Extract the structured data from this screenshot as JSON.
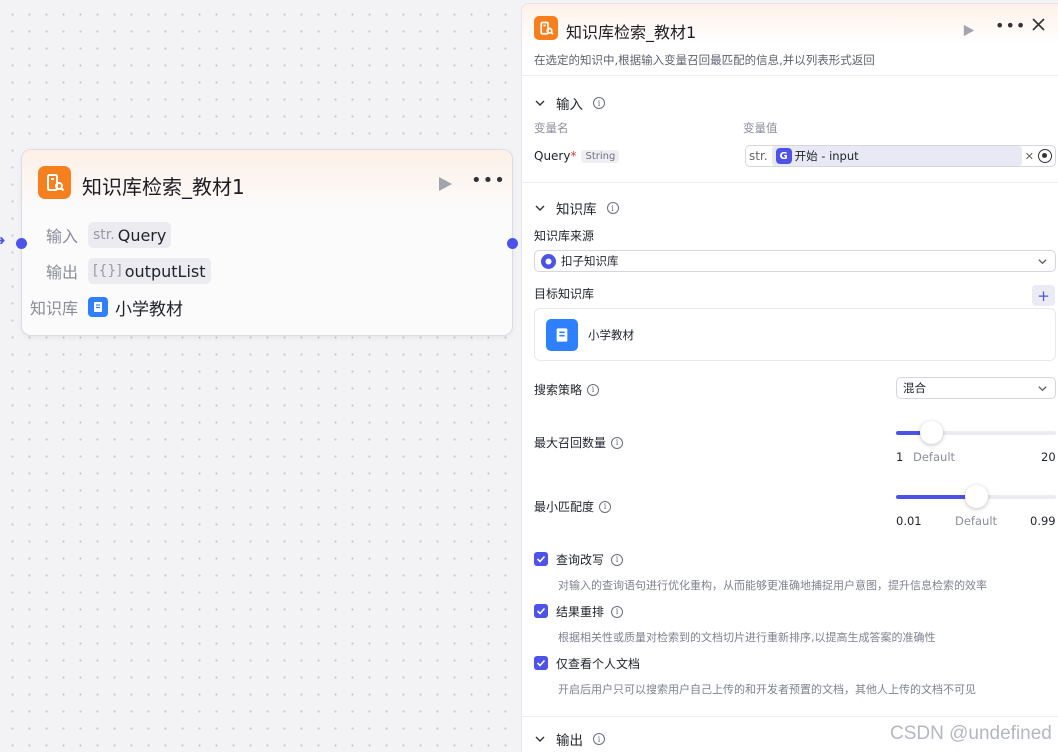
{
  "node": {
    "title": "知识库检索_教材1",
    "input_label": "输入",
    "input_type": "str.",
    "input_value": "Query",
    "output_label": "输出",
    "output_type": "[{}]",
    "output_value": "outputList",
    "kb_label": "知识库",
    "kb_value": "小学教材"
  },
  "panel": {
    "title": "知识库检索_教材1",
    "description": "在选定的知识中,根据输入变量召回最匹配的信息,并以列表形式返回",
    "input_section": {
      "title": "输入",
      "col_name": "变量名",
      "col_value": "变量值",
      "var_name": "Query",
      "required_mark": "*",
      "var_type": "String",
      "ref_prefix": "str.",
      "ref_value": "开始 - input"
    },
    "kb_section": {
      "title": "知识库",
      "source_label": "知识库来源",
      "source_value": "扣子知识库",
      "target_label": "目标知识库",
      "add_label": "+",
      "kb_item": "小学教材",
      "strategy_label": "搜索策略",
      "strategy_value": "混合",
      "max_recall_label": "最大召回数量",
      "max_recall_min": "1",
      "max_recall_default": "Default",
      "max_recall_max": "20",
      "max_recall_level": 0.22,
      "min_match_label": "最小匹配度",
      "min_match_min": "0.01",
      "min_match_default": "Default",
      "min_match_max": "0.99",
      "min_match_level": 0.5,
      "options": [
        {
          "label": "查询改写",
          "desc": "对输入的查询语句进行优化重构，从而能够更准确地捕捉用户意图，提升信息检索的效率",
          "checked": true
        },
        {
          "label": "结果重排",
          "desc": "根据相关性或质量对检索到的文档切片进行重新排序,以提高生成答案的准确性",
          "checked": true
        },
        {
          "label": "仅查看个人文档",
          "desc": "开启后用户只可以搜索用户自己上传的和开发者预置的文档，其他人上传的文档不可见",
          "checked": true
        }
      ]
    },
    "output_section": {
      "title": "输出"
    }
  },
  "watermark": "CSDN @undefined",
  "colors": {
    "accent": "#4d53e8",
    "node_icon": "#f7801e",
    "kb_icon": "#2f80ff"
  }
}
